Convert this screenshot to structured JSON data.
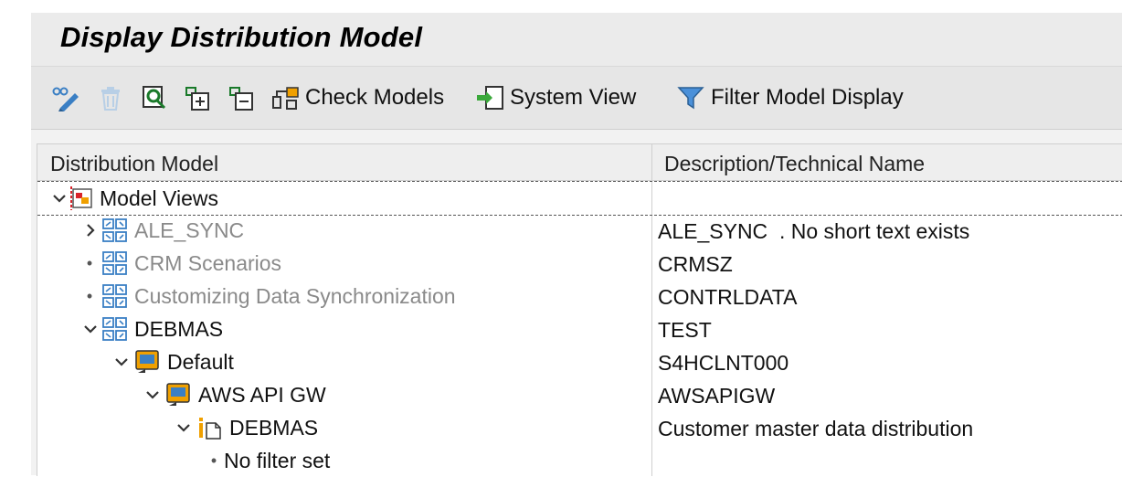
{
  "title": "Display Distribution Model",
  "toolbar": {
    "check_models": "Check Models",
    "system_view": "System View",
    "filter_model_display": "Filter Model Display"
  },
  "table": {
    "col1": "Distribution Model",
    "col2": "Description/Technical Name"
  },
  "rows": [
    {
      "label": "Model Views",
      "desc": ""
    },
    {
      "label": "ALE_SYNC",
      "desc": "ALE_SYNC  . No short text exists"
    },
    {
      "label": "CRM Scenarios",
      "desc": "CRMSZ"
    },
    {
      "label": "Customizing Data Synchronization",
      "desc": "CONTRLDATA"
    },
    {
      "label": "DEBMAS",
      "desc": "TEST"
    },
    {
      "label": "Default",
      "desc": "S4HCLNT000"
    },
    {
      "label": "AWS API GW",
      "desc": "AWSAPIGW"
    },
    {
      "label": "DEBMAS",
      "desc": "Customer master data distribution"
    },
    {
      "label": "No filter set",
      "desc": ""
    }
  ],
  "colors": {
    "accent_blue": "#3a7fc4",
    "orange": "#f0a000",
    "red": "#d8232a"
  }
}
